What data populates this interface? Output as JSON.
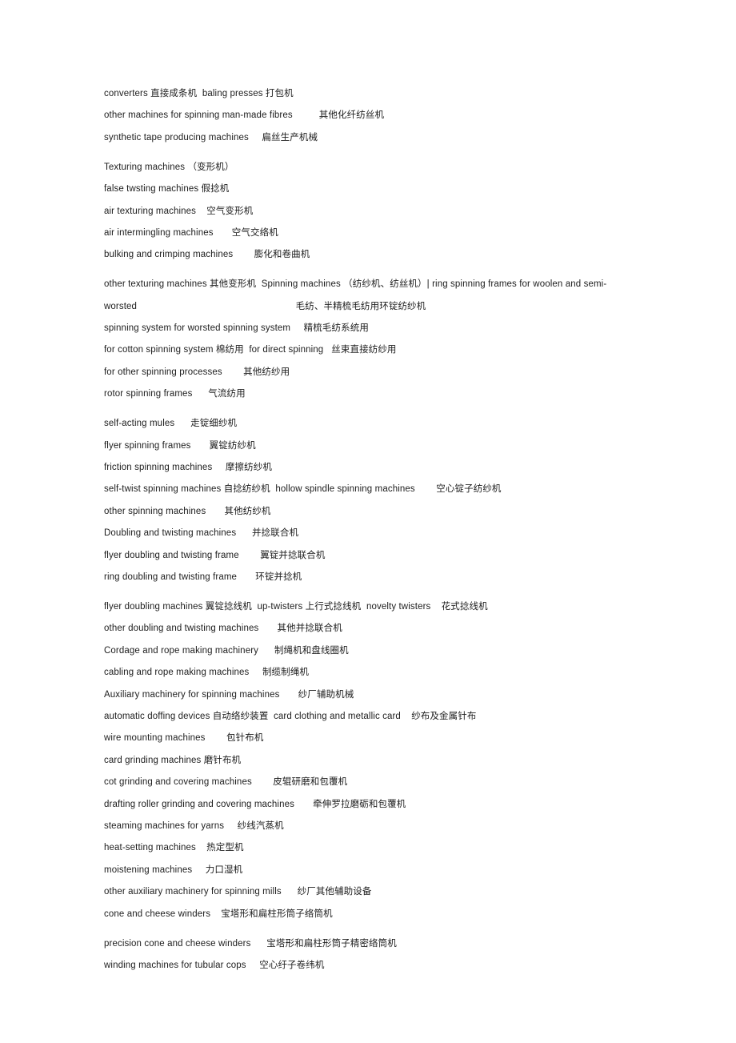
{
  "document": {
    "type": "bilingual-glossary",
    "language_pair": "English-Chinese",
    "subject": "Textile machinery terminology list",
    "page_background": "#ffffff",
    "text_color": "#1d1d1d"
  },
  "lines": [
    {
      "id": "l01",
      "text": "converters 直接成条机  baling presses 打包机",
      "gap_before": false
    },
    {
      "id": "l02",
      "text": "other machines for spinning man-made fibres          其他化纤纺丝机",
      "gap_before": false
    },
    {
      "id": "l03",
      "text": "synthetic tape producing machines     扁丝生产机械",
      "gap_before": false
    },
    {
      "id": "l04",
      "text": "Texturing machines （变形机）",
      "gap_before": true
    },
    {
      "id": "l05",
      "text": "false twsting machines 假捻机",
      "gap_before": false
    },
    {
      "id": "l06",
      "text": "air texturing machines    空气变形机",
      "gap_before": false
    },
    {
      "id": "l07",
      "text": "air intermingling machines       空气交络机",
      "gap_before": false
    },
    {
      "id": "l08",
      "text": "bulking and crimping machines        膨化和卷曲机",
      "gap_before": false
    },
    {
      "id": "l09",
      "text": "other texturing machines 其他变形机  Spinning machines （纺纱机、纺丝机）| ring spinning frames for woolen and semi-",
      "gap_before": true
    },
    {
      "id": "l10",
      "text": "worsted                                                            毛纺、半精梳毛纺用环锭纺纱机",
      "gap_before": false
    },
    {
      "id": "l11",
      "text": "spinning system for worsted spinning system     精梳毛纺系统用",
      "gap_before": false
    },
    {
      "id": "l12",
      "text": "for cotton spinning system 棉纺用  for direct spinning   丝束直接纺纱用",
      "gap_before": false
    },
    {
      "id": "l13",
      "text": "for other spinning processes        其他纺纱用",
      "gap_before": false
    },
    {
      "id": "l14",
      "text": "rotor spinning frames      气流纺用",
      "gap_before": false
    },
    {
      "id": "l15",
      "text": "self-acting mules      走锭细纱机",
      "gap_before": true
    },
    {
      "id": "l16",
      "text": "flyer spinning frames       翼锭纺纱机",
      "gap_before": false
    },
    {
      "id": "l17",
      "text": "friction spinning machines     摩擦纺纱机",
      "gap_before": false
    },
    {
      "id": "l18",
      "text": "self-twist spinning machines 自捻纺纱机  hollow spindle spinning machines        空心锭子纺纱机",
      "gap_before": false
    },
    {
      "id": "l19",
      "text": "other spinning machines       其他纺纱机",
      "gap_before": false
    },
    {
      "id": "l20",
      "text": "Doubling and twisting machines      并捻联合机",
      "gap_before": false
    },
    {
      "id": "l21",
      "text": "flyer doubling and twisting frame        翼锭并捻联合机",
      "gap_before": false
    },
    {
      "id": "l22",
      "text": "ring doubling and twisting frame       环锭并捻机",
      "gap_before": false
    },
    {
      "id": "l23",
      "text": "flyer doubling machines 翼锭捻线机  up-twisters 上行式捻线机  novelty twisters    花式捻线机",
      "gap_before": true
    },
    {
      "id": "l24",
      "text": "other doubling and twisting machines       其他并捻联合机",
      "gap_before": false
    },
    {
      "id": "l25",
      "text": "Cordage and rope making machinery      制绳机和盘线圈机",
      "gap_before": false
    },
    {
      "id": "l26",
      "text": "cabling and rope making machines     制缆制绳机",
      "gap_before": false
    },
    {
      "id": "l27",
      "text": "Auxiliary machinery for spinning machines       纱厂辅助机械",
      "gap_before": false
    },
    {
      "id": "l28",
      "text": "automatic doffing devices 自动络纱装置  card clothing and metallic card    纱布及金属针布",
      "gap_before": false
    },
    {
      "id": "l29",
      "text": "wire mounting machines        包针布机",
      "gap_before": false
    },
    {
      "id": "l30",
      "text": "card grinding machines 磨针布机",
      "gap_before": false
    },
    {
      "id": "l31",
      "text": "cot grinding and covering machines        皮辊研磨和包覆机",
      "gap_before": false
    },
    {
      "id": "l32",
      "text": "drafting roller grinding and covering machines       牵伸罗拉磨砺和包覆机",
      "gap_before": false
    },
    {
      "id": "l33",
      "text": "steaming machines for yarns     纱线汽蒸机",
      "gap_before": false
    },
    {
      "id": "l34",
      "text": "heat-setting machines    热定型机",
      "gap_before": false
    },
    {
      "id": "l35",
      "text": "moistening machines     力口湿机",
      "gap_before": false
    },
    {
      "id": "l36",
      "text": "other auxiliary machinery for spinning mills      纱厂其他辅助设备",
      "gap_before": false
    },
    {
      "id": "l37",
      "text": "cone and cheese winders    宝塔形和扁柱形筒子络筒机",
      "gap_before": false
    },
    {
      "id": "l38",
      "text": "precision cone and cheese winders      宝塔形和扁柱形筒子精密络筒机",
      "gap_before": true
    },
    {
      "id": "l39",
      "text": "winding machines for tubular cops     空心纡子卷纬机",
      "gap_before": false
    }
  ]
}
